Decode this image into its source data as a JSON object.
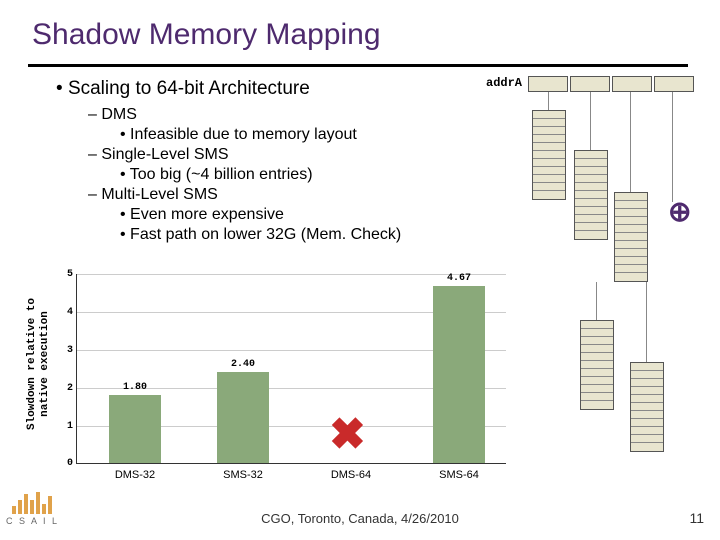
{
  "title": "Shadow Memory Mapping",
  "bullets": {
    "b1": "Scaling to 64-bit Architecture",
    "b2a": "DMS",
    "b3a": "Infeasible due to memory layout",
    "b2b": "Single-Level SMS",
    "b3b": "Too big (~4 billion entries)",
    "b2c": "Multi-Level SMS",
    "b3c": "Even more expensive",
    "b3d": "Fast path on lower 32G (Mem. Check)"
  },
  "diagram": {
    "addr_label": "addrA",
    "combine_symbol": "⊕"
  },
  "chart_data": {
    "type": "bar",
    "categories": [
      "DMS-32",
      "SMS-32",
      "DMS-64",
      "SMS-64"
    ],
    "values": [
      1.8,
      2.4,
      null,
      4.67
    ],
    "value_labels": [
      "1.80",
      "2.40",
      "",
      "4.67"
    ],
    "annotations": {
      "2": "✖"
    },
    "ylabel": "Slowdown relative to\nnative execution",
    "ylim": [
      0,
      5
    ],
    "yticks": [
      0,
      1,
      2,
      3,
      4,
      5
    ]
  },
  "footer": "CGO, Toronto, Canada, 4/26/2010",
  "page_number": "11",
  "logo_text": "C S A I L"
}
